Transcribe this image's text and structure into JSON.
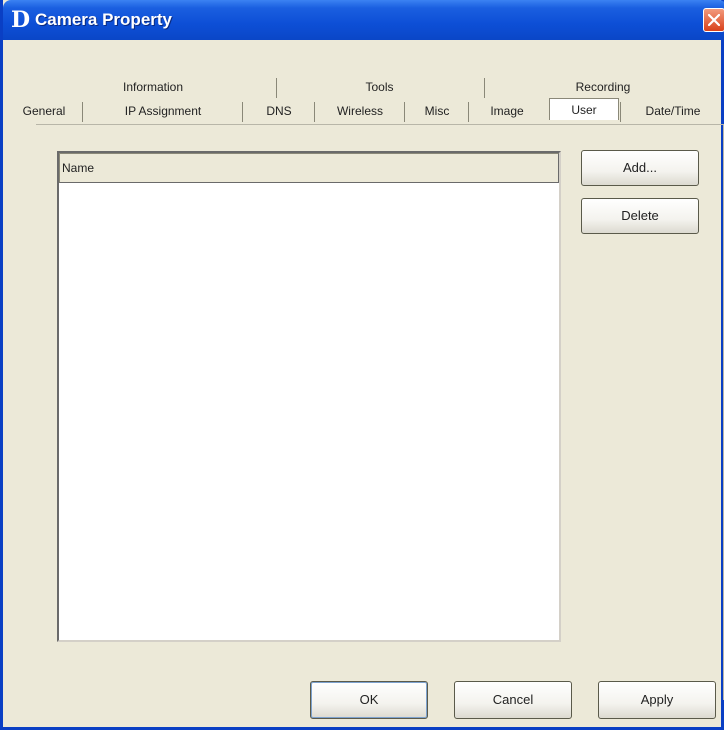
{
  "window": {
    "app_icon_letter": "D",
    "title": "Camera Property"
  },
  "tabs": {
    "top_row": [
      {
        "label": "Information"
      },
      {
        "label": "Tools"
      },
      {
        "label": "Recording"
      }
    ],
    "bottom_row": [
      {
        "label": "General"
      },
      {
        "label": "IP Assignment"
      },
      {
        "label": "DNS"
      },
      {
        "label": "Wireless"
      },
      {
        "label": "Misc"
      },
      {
        "label": "Image"
      },
      {
        "label": "User",
        "active": true
      },
      {
        "label": "Date/Time"
      }
    ]
  },
  "user_list": {
    "columns": [
      "Name"
    ],
    "rows": []
  },
  "side_buttons": {
    "add_label": "Add...",
    "delete_label": "Delete"
  },
  "footer_buttons": {
    "ok_label": "OK",
    "cancel_label": "Cancel",
    "apply_label": "Apply"
  },
  "colors": {
    "titlebar": "#0d4fd6",
    "window_bg": "#ece9d8",
    "close_button": "#d9411b"
  }
}
